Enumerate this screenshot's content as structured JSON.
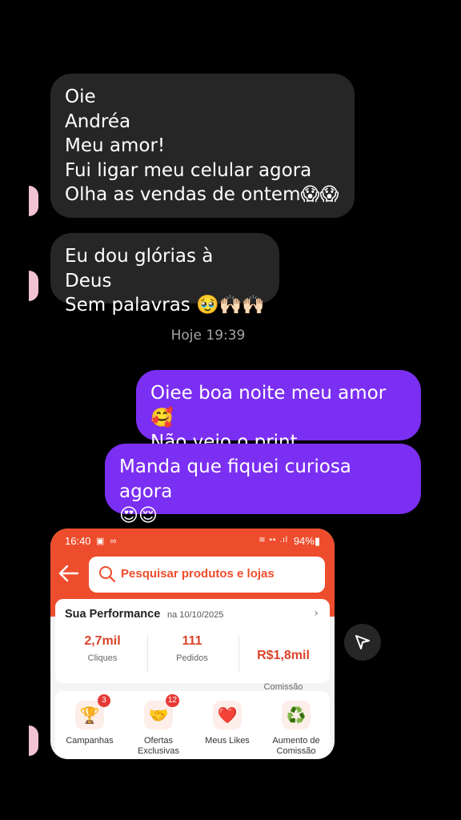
{
  "messages": {
    "incoming_1": "Oie\nAndréa\nMeu amor!\nFui ligar meu celular agora\nOlha as vendas de ontem😱😱",
    "incoming_2": "Eu dou glórias à Deus\nSem palavras 🥹🙌🏻🙌🏻",
    "timestamp": "Hoje 19:39",
    "outgoing_1": "Oiee boa noite meu amor 🥰\nNão veio o print",
    "outgoing_2": "Manda que fiquei curiosa agora\n😍😌"
  },
  "screenshot": {
    "status_time": "16:40",
    "status_left_icons": "▣ ∞",
    "status_right_icons": "≋ ▪▪ .ıl",
    "battery": "94%▮",
    "search_placeholder": "Pesquisar produtos e lojas",
    "performance": {
      "title": "Sua Performance",
      "date": "na 10/10/2025",
      "stats": [
        {
          "value": "2,7mil",
          "label": "Cliques"
        },
        {
          "value": "111",
          "label": "Pedidos"
        },
        {
          "value": "R$1,8mil",
          "label": "Comissão\nEstimada"
        }
      ]
    },
    "tools": [
      {
        "label": "Campanhas",
        "badge": "3",
        "icon": "trophy-icon",
        "glyph": "🏆"
      },
      {
        "label": "Ofertas\nExclusivas",
        "badge": "12",
        "icon": "handshake-icon",
        "glyph": "🤝"
      },
      {
        "label": "Meus Likes",
        "badge": "",
        "icon": "heart-icon",
        "glyph": "❤️"
      },
      {
        "label": "Aumento de\nComissão",
        "badge": "",
        "icon": "percent-cycle-icon",
        "glyph": "♻️"
      }
    ]
  },
  "colors": {
    "outgoing_bubble": "#7b2ff2",
    "incoming_bubble": "#262626",
    "shopee_orange": "#ee4d2d"
  }
}
